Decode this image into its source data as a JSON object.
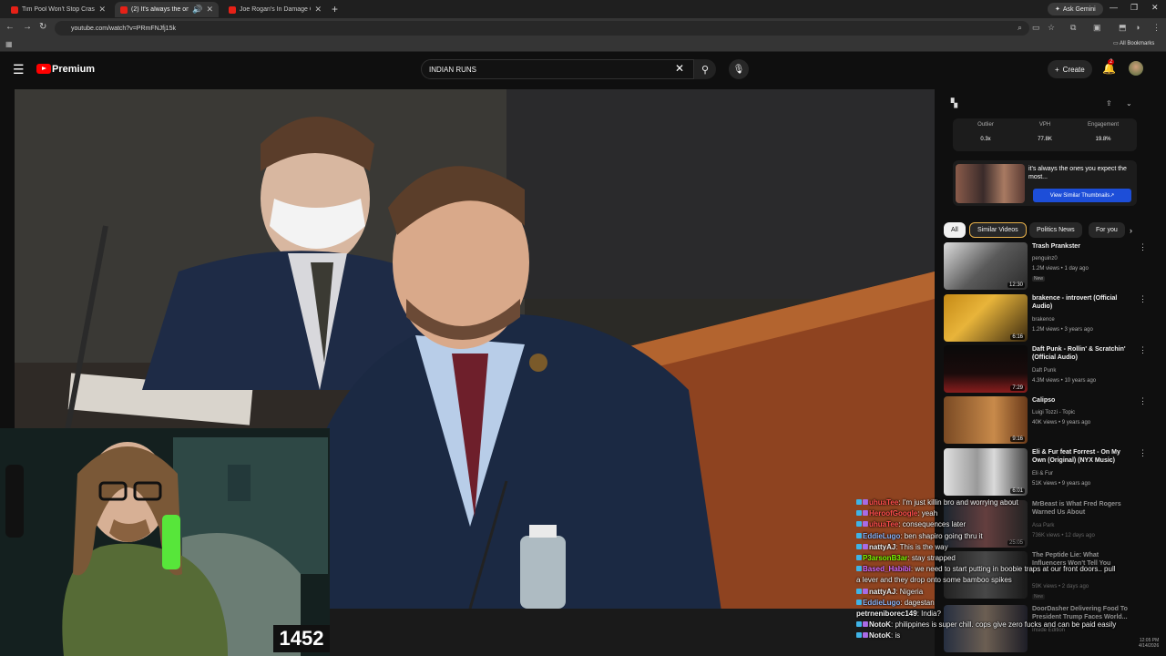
{
  "browser": {
    "tabs": [
      {
        "title": "Tim Pool Won't Stop Crashing O",
        "active": false
      },
      {
        "title": "(2) It's always the ones you",
        "active": true
      },
      {
        "title": "Joe Rogan's In Damage Contro",
        "active": false
      }
    ],
    "url": "youtube.com/watch?v=PRmFNJfj15k",
    "ask_gemini": "Ask Gemini",
    "all_bookmarks": "All Bookmarks"
  },
  "youtube": {
    "logo_text": "Premium",
    "search_value": "INDIAN RUNS",
    "create_label": "Create",
    "notifications": "2"
  },
  "extension": {
    "stats": [
      {
        "label": "Outlier",
        "value": "0.3x"
      },
      {
        "label": "VPH",
        "value": "77.8K"
      },
      {
        "label": "Engagement",
        "value": "19.8%"
      }
    ],
    "thumb_title": "it's always the ones you expect the most...",
    "similar_button": "View Similar Thumbnails"
  },
  "chips": [
    "All",
    "Similar Videos",
    "Politics News",
    "For you"
  ],
  "recommendations": [
    {
      "title": "Trash Prankster",
      "channel": "penguinz0",
      "meta": "1.2M views • 1 day ago",
      "badge": "New",
      "duration": "12:30"
    },
    {
      "title": "brakence - introvert (Official Audio)",
      "channel": "brakence",
      "meta": "1.2M views • 3 years ago",
      "duration": "6:16"
    },
    {
      "title": "Daft Punk - Rollin' & Scratchin' (Official Audio)",
      "channel": "Daft Punk",
      "meta": "4.3M views • 10 years ago",
      "duration": "7:29"
    },
    {
      "title": "Calipso",
      "channel": "Luigi Tozzi - Topic",
      "meta": "40K views • 9 years ago",
      "duration": "9:16"
    },
    {
      "title": "Eli & Fur feat Forrest - On My Own (Original) (NYX Music)",
      "channel": "Eli & Fur",
      "meta": "51K views • 9 years ago",
      "duration": "6:01"
    },
    {
      "title": "MrBeast is What Fred Rogers Warned Us About",
      "channel": "Asa Park",
      "meta": "736K views • 12 days ago",
      "duration": "25:05"
    },
    {
      "title": "The Peptide Lie: What Influencers Won't Tell You",
      "channel": "",
      "meta": "59K views • 2 days ago",
      "badge": "New",
      "duration": ""
    },
    {
      "title": "DoorDasher Delivering Food To President Trump Faces World...",
      "channel": "Inside Edition",
      "meta": "",
      "duration": ""
    }
  ],
  "chat": [
    {
      "user": "uhuaTee",
      "msg": "I'm just killin bro and worrying about",
      "color": "#ff4d4d"
    },
    {
      "user": "HeroofGoogle",
      "msg": "yeah",
      "color": "#ff4d4d"
    },
    {
      "user": "uhuaTee",
      "msg": "consequences later",
      "color": "#ff4d4d"
    },
    {
      "user": "EddieLugo",
      "msg": "ben shapiro going thru it",
      "color": "#8ab4f8"
    },
    {
      "user": "nattyAJ",
      "msg": "This is the way",
      "color": "#f1f1f1"
    },
    {
      "user": "P3arsonB3ar",
      "msg": "stay strapped",
      "color": "#7cfc00"
    },
    {
      "user": "Based_Habibi",
      "msg": "we need to start putting in boobie traps at our front doors.. pull",
      "color": "#d36bff"
    },
    {
      "user": "",
      "msg": "a lever and they drop onto some bamboo spikes",
      "color": "#ffffff"
    },
    {
      "user": "nattyAJ",
      "msg": "Nigeria",
      "color": "#f1f1f1"
    },
    {
      "user": "EddieLugo",
      "msg": "dagestan",
      "color": "#8ab4f8"
    },
    {
      "user": "petrneniborec149",
      "msg": "India?",
      "color": "#f1f1f1"
    },
    {
      "user": "NotoK",
      "msg": "philippines is super chill. cops give zero fucks and can be paid easily",
      "color": "#f1f1f1"
    },
    {
      "user": "NotoK",
      "msg": "is",
      "color": "#f1f1f1"
    }
  ],
  "counter": "1452",
  "taskbar_time": "12:05 PM",
  "taskbar_date": "4/14/2026"
}
